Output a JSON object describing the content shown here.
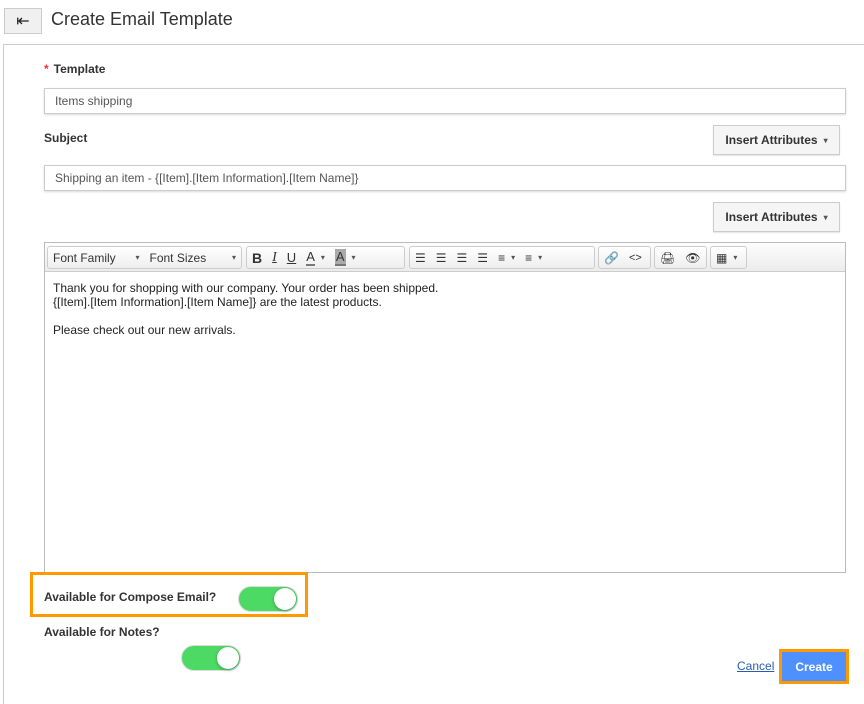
{
  "header": {
    "back_icon": "arrow-left-icon",
    "title": "Create Email Template"
  },
  "form": {
    "template_label": "Template",
    "required_mark": "*",
    "template_value": "Items shipping",
    "subject_label": "Subject",
    "subject_value": "Shipping an item - {[Item].[Item Information].[Item Name]}",
    "insert_attributes": "Insert Attributes",
    "caret": "▾"
  },
  "editor": {
    "font_family": "Font Family",
    "font_sizes": "Font Sizes",
    "tools": [
      "bold",
      "italic",
      "underline",
      "font-color",
      "highlight-color",
      "align-left",
      "align-center",
      "align-right",
      "justify",
      "bullet-list",
      "numbered-list",
      "link",
      "code-view",
      "print",
      "preview",
      "table"
    ],
    "lines": [
      "Thank you for shopping with our company. Your order has been shipped.",
      "{[Item].[Item Information].[Item Name]} are the latest products.",
      "",
      "Please check out our new arrivals."
    ]
  },
  "toggles": {
    "compose_label": "Available for Compose Email?",
    "compose_on": true,
    "notes_label": "Available for Notes?",
    "notes_on": true
  },
  "actions": {
    "cancel": "Cancel",
    "create": "Create"
  },
  "colors": {
    "accent": "#4d90fe",
    "highlight": "#ff9900",
    "toggle_on": "#4cd964"
  }
}
